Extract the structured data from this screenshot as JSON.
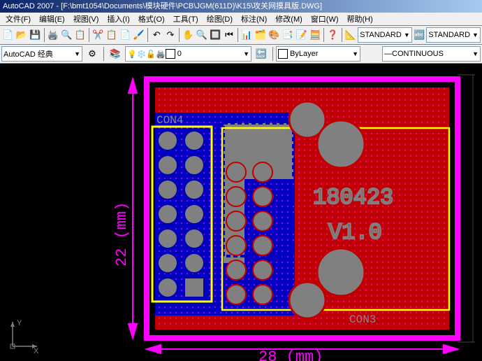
{
  "title": "AutoCAD 2007 - [F:\\bmt1054\\Documents\\模块硬件\\PCB\\JGM(611D)\\K15\\攻关网摸具版.DWG]",
  "menu": {
    "file": "文件(F)",
    "edit": "编辑(E)",
    "view": "视图(V)",
    "insert": "插入(I)",
    "format": "格式(O)",
    "tools": "工具(T)",
    "draw": "绘图(D)",
    "dimension": "标注(N)",
    "modify": "修改(M)",
    "window": "窗口(W)",
    "help": "帮助(H)"
  },
  "workspace": {
    "label": "AutoCAD 经典"
  },
  "layer": {
    "value": "0"
  },
  "bylayer": {
    "value": "ByLayer"
  },
  "standard1": {
    "value": "STANDARD"
  },
  "standard2": {
    "value": "STANDARD"
  },
  "linetype": {
    "value": "CONTINUOUS"
  },
  "pcb": {
    "label1": "CON4",
    "label2": "CON3",
    "text1": "180423",
    "text2": "V1.0",
    "dim_w": "28  (mm)",
    "dim_h": "22  (mm)"
  },
  "ucs": {
    "x": "X",
    "y": "Y"
  }
}
